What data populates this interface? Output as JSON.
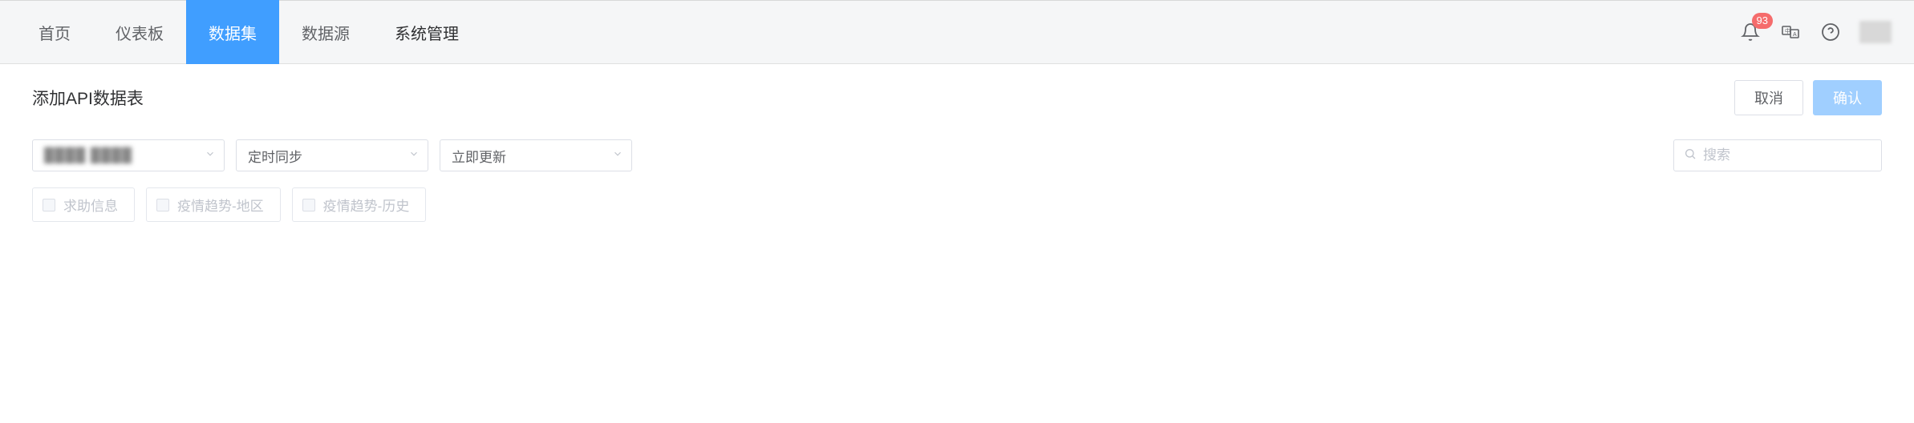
{
  "nav": {
    "items": [
      {
        "label": "首页",
        "active": false
      },
      {
        "label": "仪表板",
        "active": false
      },
      {
        "label": "数据集",
        "active": true
      },
      {
        "label": "数据源",
        "active": false
      },
      {
        "label": "系统管理",
        "active": false
      }
    ],
    "notification_count": "93"
  },
  "page": {
    "title": "添加API数据表",
    "cancel_label": "取消",
    "confirm_label": "确认"
  },
  "filters": {
    "select1_value": "████ ████",
    "select2_value": "定时同步",
    "select3_value": "立即更新",
    "search_placeholder": "搜索"
  },
  "tags": [
    {
      "label": "求助信息"
    },
    {
      "label": "疫情趋势-地区"
    },
    {
      "label": "疫情趋势-历史"
    }
  ]
}
